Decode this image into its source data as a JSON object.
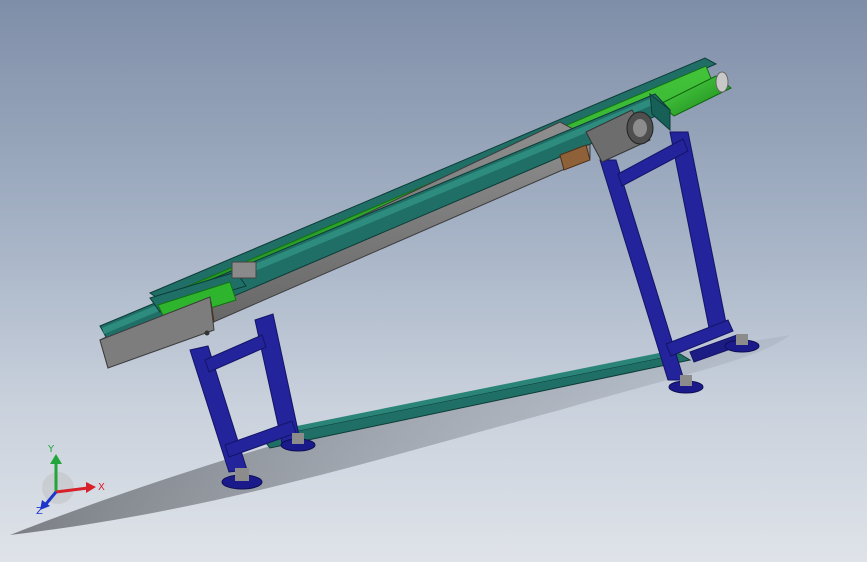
{
  "triad": {
    "y_label": "Y",
    "x_label": "X",
    "z_label": "Z",
    "x_color": "#d8202a",
    "y_color": "#22a53a",
    "z_color": "#1d36c9"
  },
  "colors": {
    "frame_blue": "#23239b",
    "frame_blue_dark": "#141466",
    "conveyor_teal": "#1f6f66",
    "belt_green": "#2fb52d",
    "side_plate_gray": "#7b7b7b",
    "motor_gray": "#6d6d6d",
    "bracket_brown": "#8f6139"
  }
}
